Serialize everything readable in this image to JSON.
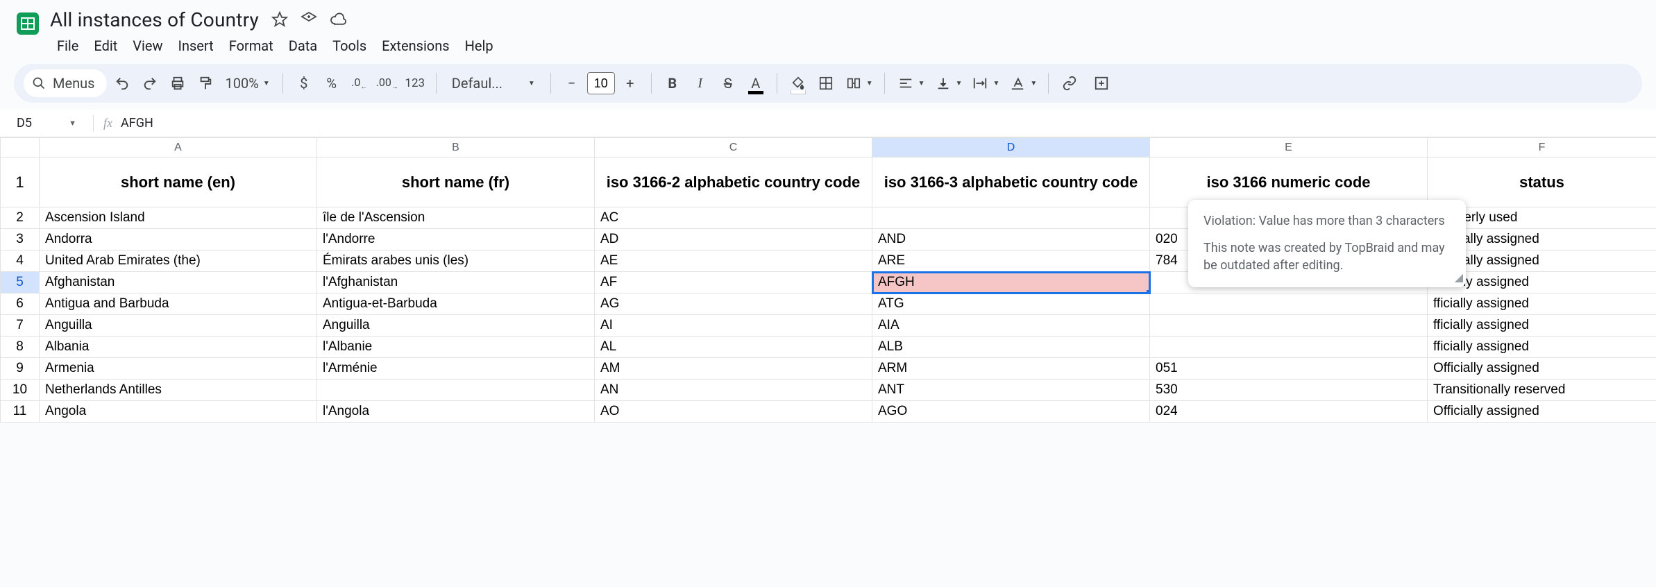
{
  "doc": {
    "title": "All instances of Country"
  },
  "menubar": {
    "file": "File",
    "edit": "Edit",
    "view": "View",
    "insert": "Insert",
    "format": "Format",
    "data": "Data",
    "tools": "Tools",
    "extensions": "Extensions",
    "help": "Help"
  },
  "toolbar": {
    "menus": "Menus",
    "zoom": "100%",
    "currency": "$",
    "percent": "%",
    "d_dec": ".0",
    "i_dec": ".00",
    "num": "123",
    "font": "Defaul...",
    "fontsize": "10"
  },
  "namebox": {
    "ref": "D5"
  },
  "formula": {
    "value": "AFGH"
  },
  "columns": [
    "A",
    "B",
    "C",
    "D",
    "E",
    "F"
  ],
  "selected_column": "D",
  "selected_row": "5",
  "headers": {
    "a": "short name (en)",
    "b": "short name (fr)",
    "c": "iso 3166-2 alphabetic country code",
    "d": "iso 3166-3 alphabetic country code",
    "e": "iso 3166 numeric code",
    "f": "status"
  },
  "rows": [
    {
      "n": "2",
      "a": "Ascension Island",
      "b": "île de l'Ascension",
      "c": "AC",
      "d": "",
      "e": "",
      "f": "Formerly used"
    },
    {
      "n": "3",
      "a": "Andorra",
      "b": "l'Andorre",
      "c": "AD",
      "d": "AND",
      "e": "020",
      "f": "Officially assigned"
    },
    {
      "n": "4",
      "a": "United Arab Emirates (the)",
      "b": "Émirats arabes unis (les)",
      "c": "AE",
      "d": "ARE",
      "e": "784",
      "f": "Officially assigned"
    },
    {
      "n": "5",
      "a": "Afghanistan",
      "b": "l'Afghanistan",
      "c": "AF",
      "d": "AFGH",
      "e": "",
      "f": "fficially assigned"
    },
    {
      "n": "6",
      "a": "Antigua and Barbuda",
      "b": "Antigua-et-Barbuda",
      "c": "AG",
      "d": "ATG",
      "e": "",
      "f": "fficially assigned"
    },
    {
      "n": "7",
      "a": "Anguilla",
      "b": "Anguilla",
      "c": "AI",
      "d": "AIA",
      "e": "",
      "f": "fficially assigned"
    },
    {
      "n": "8",
      "a": "Albania",
      "b": "l'Albanie",
      "c": "AL",
      "d": "ALB",
      "e": "",
      "f": "fficially assigned"
    },
    {
      "n": "9",
      "a": "Armenia",
      "b": "l'Arménie",
      "c": "AM",
      "d": "ARM",
      "e": "051",
      "f": "Officially assigned"
    },
    {
      "n": "10",
      "a": "Netherlands Antilles",
      "b": "",
      "c": "AN",
      "d": "ANT",
      "e": "530",
      "f": "Transitionally reserved"
    },
    {
      "n": "11",
      "a": "Angola",
      "b": "l'Angola",
      "c": "AO",
      "d": "AGO",
      "e": "024",
      "f": "Officially assigned"
    }
  ],
  "tooltip": {
    "line1": "Violation: Value has more than 3 characters",
    "line2": "This note was created by TopBraid and may be outdated after editing."
  }
}
